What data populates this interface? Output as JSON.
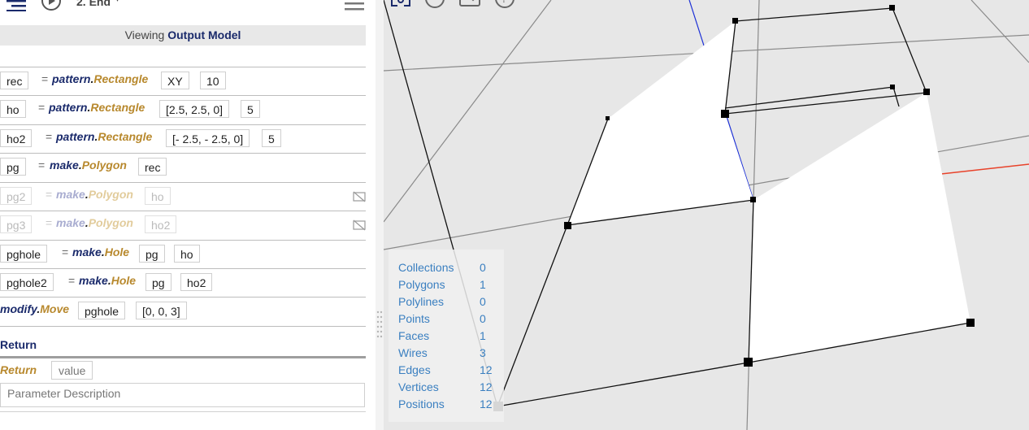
{
  "header": {
    "title": "2. End",
    "viewing_prefix": "Viewing",
    "viewing_model": "Output Model"
  },
  "procedure": [
    {
      "var": "rec",
      "module": "pattern",
      "func": "Rectangle",
      "args": [
        "XY",
        "10"
      ],
      "disabled": false
    },
    {
      "var": "ho",
      "module": "pattern",
      "func": "Rectangle",
      "args": [
        "[2.5, 2.5, 0]",
        "5"
      ],
      "disabled": false
    },
    {
      "var": "ho2",
      "module": "pattern",
      "func": "Rectangle",
      "args": [
        "[- 2.5, - 2.5, 0]",
        "5"
      ],
      "disabled": false
    },
    {
      "var": "pg",
      "module": "make",
      "func": "Polygon",
      "args": [
        "rec"
      ],
      "disabled": false
    },
    {
      "var": "pg2",
      "module": "make",
      "func": "Polygon",
      "args": [
        "ho"
      ],
      "disabled": true
    },
    {
      "var": "pg3",
      "module": "make",
      "func": "Polygon",
      "args": [
        "ho2"
      ],
      "disabled": true
    },
    {
      "var": "pghole",
      "module": "make",
      "func": "Hole",
      "args": [
        "pg",
        "ho"
      ],
      "disabled": false
    },
    {
      "var": "pghole2",
      "module": "make",
      "func": "Hole",
      "args": [
        "pg",
        "ho2"
      ],
      "disabled": false
    },
    {
      "var": "",
      "module": "modify",
      "func": "Move",
      "args": [
        "pghole",
        "[0, 0, 3]"
      ],
      "disabled": false
    }
  ],
  "return_section": {
    "heading": "Return",
    "keyword": "Return",
    "value_placeholder": "value",
    "description_placeholder": "Parameter Description"
  },
  "stats": [
    {
      "label": "Collections",
      "value": "0"
    },
    {
      "label": "Polygons",
      "value": "1"
    },
    {
      "label": "Polylines",
      "value": "0"
    },
    {
      "label": "Points",
      "value": "0"
    },
    {
      "label": "Faces",
      "value": "1"
    },
    {
      "label": "Wires",
      "value": "3"
    },
    {
      "label": "Edges",
      "value": "12"
    },
    {
      "label": "Vertices",
      "value": "12"
    },
    {
      "label": "Positions",
      "value": "12"
    }
  ],
  "colors": {
    "module": "#1a2a6b",
    "function": "#b8892e",
    "stats_text": "#3a7fc0",
    "axis_x": "#e8432b",
    "axis_y": "#1b2fd6",
    "viewport_bg": "#e7e7e7"
  },
  "icons": [
    "menu-icon",
    "play-icon",
    "chevron-down-icon",
    "hamburger-icon",
    "focus-icon",
    "circle-icon",
    "screenshot-icon",
    "help-icon",
    "hidden-icon",
    "drag-handle-icon"
  ]
}
